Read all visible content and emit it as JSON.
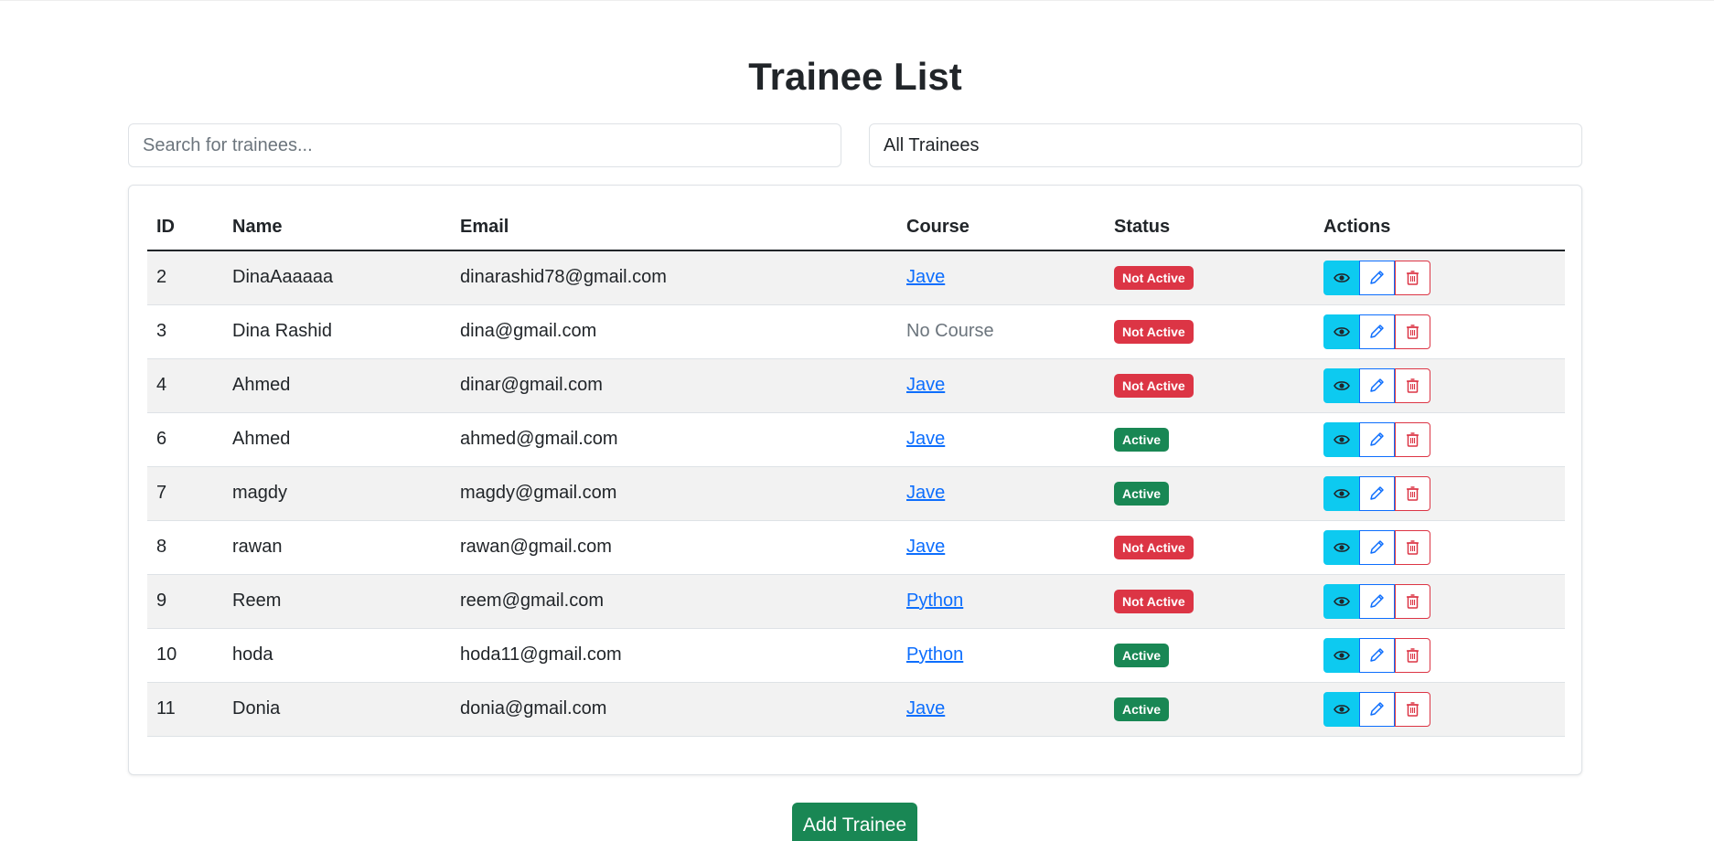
{
  "page": {
    "title": "Trainee List"
  },
  "search": {
    "placeholder": "Search for trainees..."
  },
  "filter": {
    "selected": "All Trainees"
  },
  "table": {
    "headers": [
      "ID",
      "Name",
      "Email",
      "Course",
      "Status",
      "Actions"
    ],
    "rows": [
      {
        "id": "2",
        "name": "DinaAaaaaa",
        "email": "dinarashid78@gmail.com",
        "course": "Jave",
        "status": "Not Active"
      },
      {
        "id": "3",
        "name": "Dina Rashid",
        "email": "dina@gmail.com",
        "course": "No Course",
        "status": "Not Active"
      },
      {
        "id": "4",
        "name": "Ahmed",
        "email": "dinar@gmail.com",
        "course": "Jave",
        "status": "Not Active"
      },
      {
        "id": "6",
        "name": "Ahmed",
        "email": "ahmed@gmail.com",
        "course": "Jave",
        "status": "Active"
      },
      {
        "id": "7",
        "name": "magdy",
        "email": "magdy@gmail.com",
        "course": "Jave",
        "status": "Active"
      },
      {
        "id": "8",
        "name": "rawan",
        "email": "rawan@gmail.com",
        "course": "Jave",
        "status": "Not Active"
      },
      {
        "id": "9",
        "name": "Reem",
        "email": "reem@gmail.com",
        "course": "Python",
        "status": "Not Active"
      },
      {
        "id": "10",
        "name": "hoda",
        "email": "hoda11@gmail.com",
        "course": "Python",
        "status": "Active"
      },
      {
        "id": "11",
        "name": "Donia",
        "email": "donia@gmail.com",
        "course": "Jave",
        "status": "Active"
      }
    ],
    "action_icons": [
      "eye-icon",
      "pencil-icon",
      "trash-icon"
    ]
  },
  "footer": {
    "add_label": "Add Trainee"
  },
  "colors": {
    "active": "#198754",
    "inactive": "#dc3545",
    "view": "#0dcaf0",
    "edit": "#0d6efd",
    "delete": "#dc3545",
    "link": "#0d6efd"
  }
}
